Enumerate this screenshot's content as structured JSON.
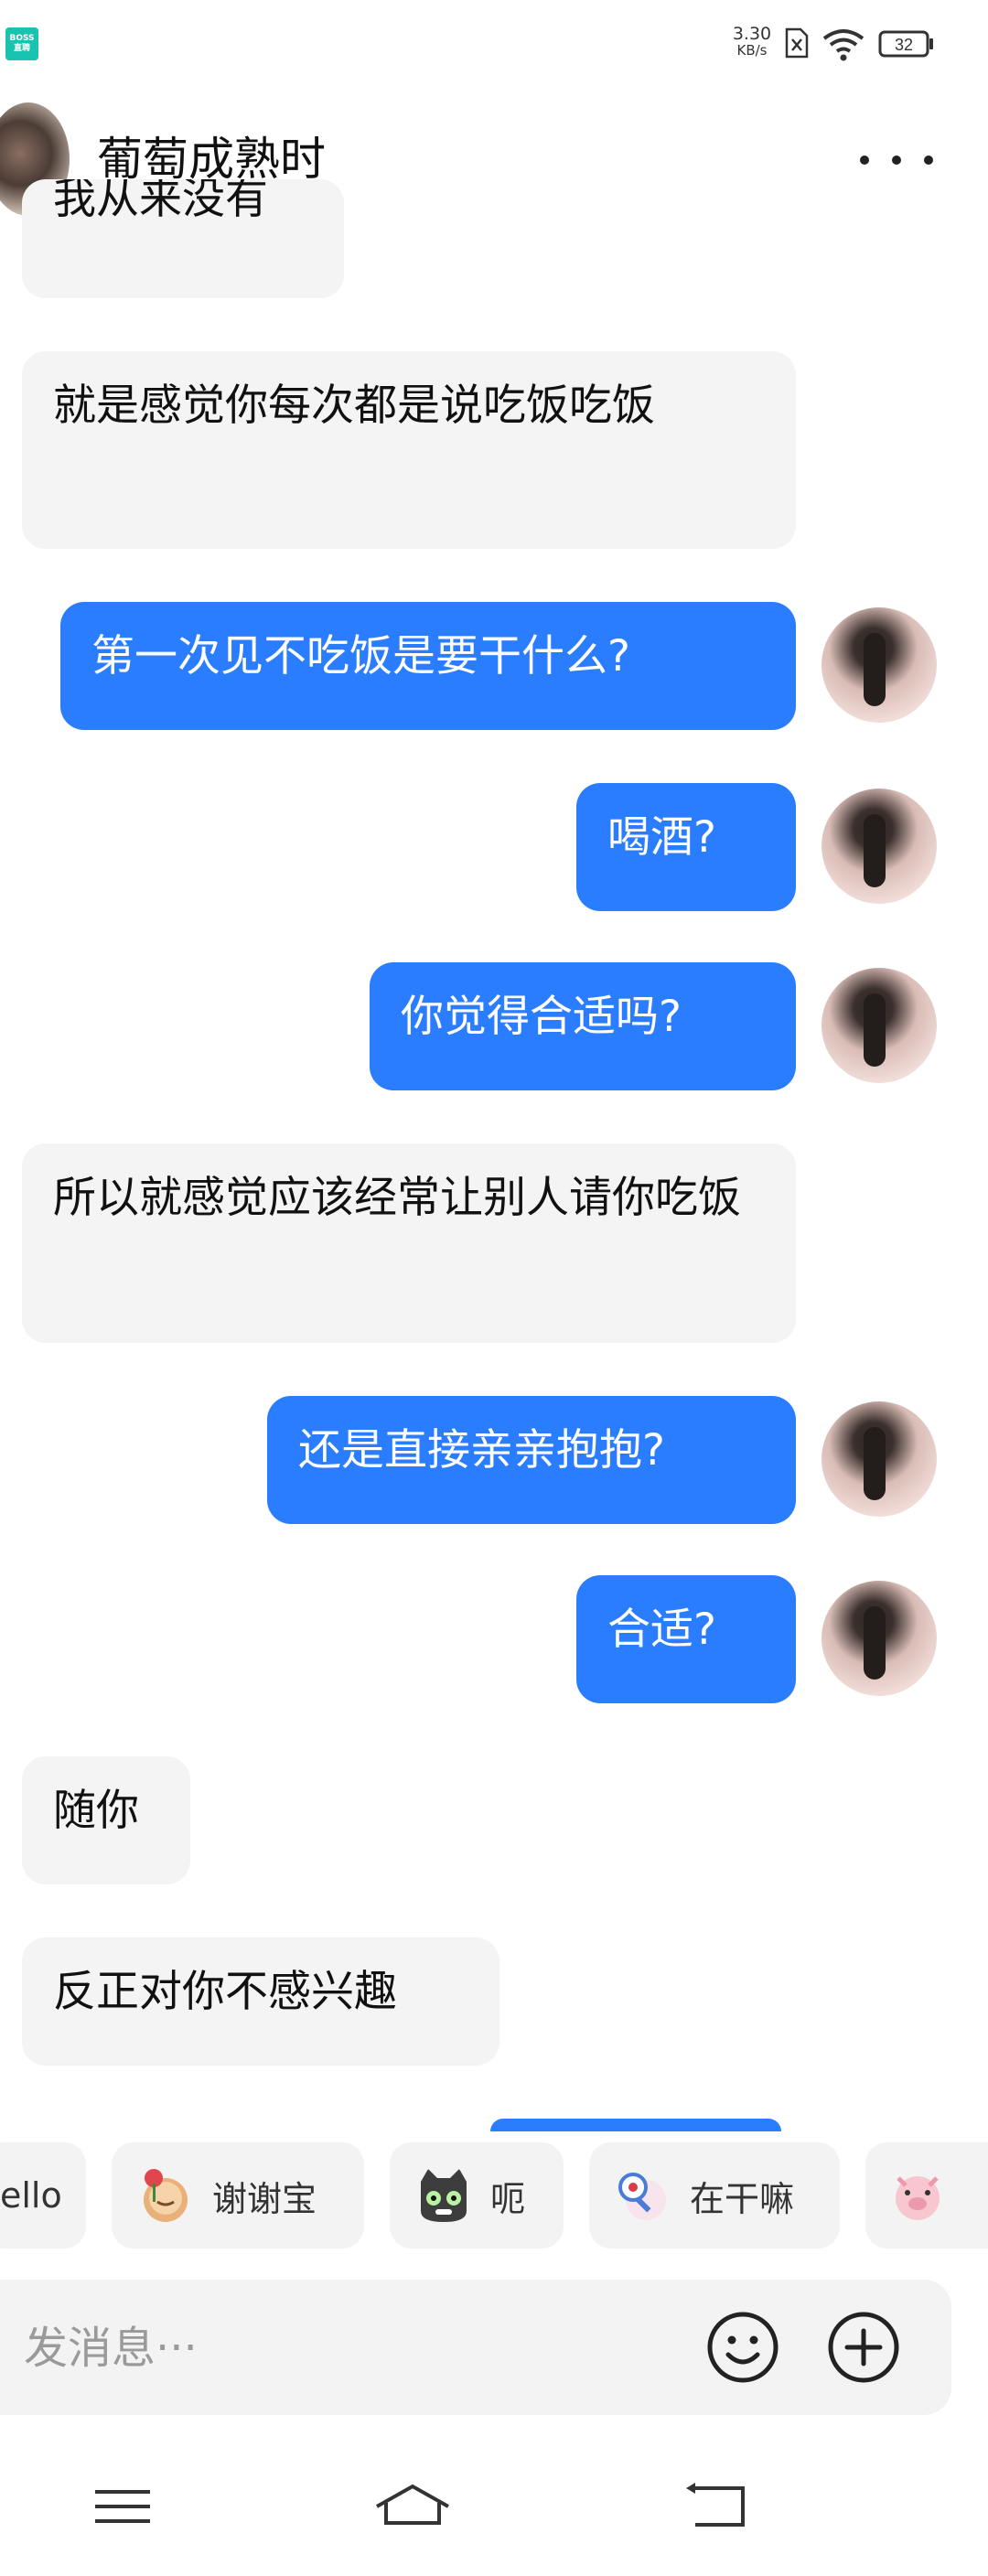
{
  "status_bar": {
    "app_badge_line1": "BOSS",
    "app_badge_line2": "直聘",
    "net_speed": "3.30",
    "net_unit": "KB/s",
    "battery": "32",
    "icons": [
      "sim-x-icon",
      "wifi-icon",
      "battery-icon"
    ]
  },
  "header": {
    "title": "葡萄成熟时",
    "menu_icon": "more-dots-icon"
  },
  "messages": [
    {
      "side": "in",
      "text": "我从来没有"
    },
    {
      "side": "in",
      "text": "就是感觉你每次都是说吃饭吃饭"
    },
    {
      "side": "out",
      "text": "第一次见不吃饭是要干什么?"
    },
    {
      "side": "out",
      "text": "喝酒?"
    },
    {
      "side": "out",
      "text": "你觉得合适吗?"
    },
    {
      "side": "in",
      "text": "所以就感觉应该经常让别人请你吃饭"
    },
    {
      "side": "out",
      "text": "还是直接亲亲抱抱?"
    },
    {
      "side": "out",
      "text": "合适?"
    },
    {
      "side": "in",
      "text": "随你"
    },
    {
      "side": "in",
      "text": "反正对你不感兴趣"
    }
  ],
  "quick_replies": [
    {
      "label": "ello",
      "icon": ""
    },
    {
      "label": "谢谢宝",
      "icon": "rose-sticker-icon"
    },
    {
      "label": "呃",
      "icon": "cat-sticker-icon"
    },
    {
      "label": "在干嘛",
      "icon": "magnifier-sticker-icon"
    },
    {
      "label": "",
      "icon": "pig-sticker-icon"
    }
  ],
  "input": {
    "placeholder": "发消息···",
    "emoji_icon": "smiley-icon",
    "plus_icon": "plus-circle-icon"
  },
  "nav": {
    "icons": [
      "menu-icon",
      "home-icon",
      "back-icon"
    ]
  },
  "colors": {
    "outgoing": "#2b7dff",
    "incoming": "#f4f4f4",
    "app_badge": "#19c3b0"
  }
}
